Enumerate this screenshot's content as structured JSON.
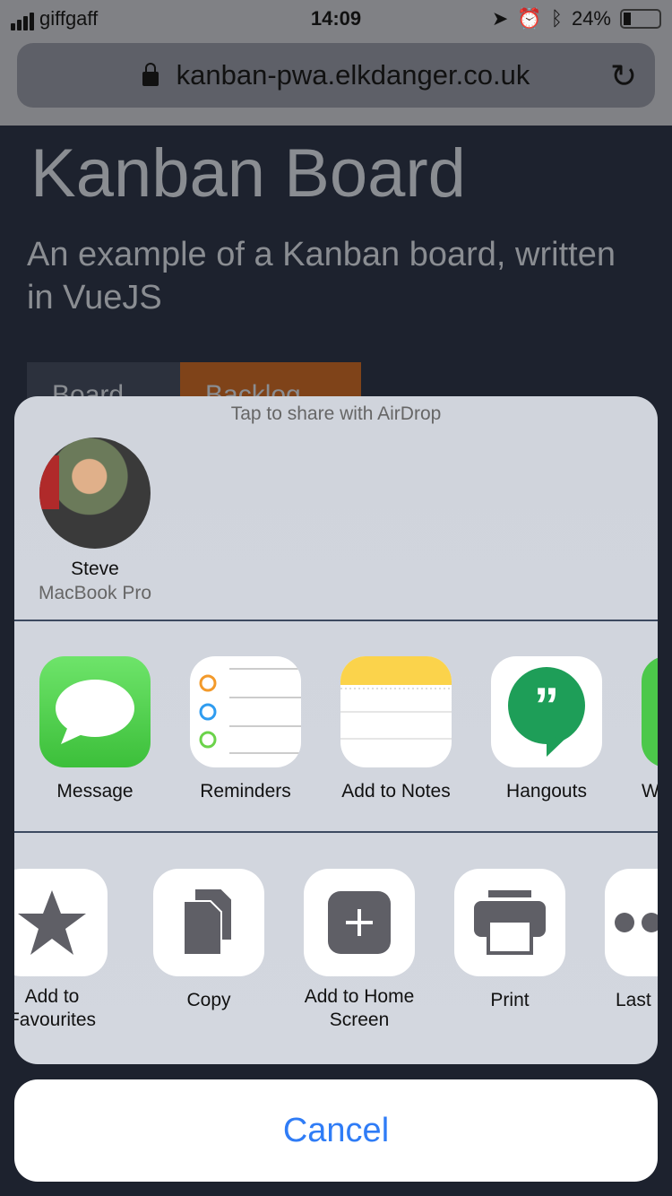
{
  "status_bar": {
    "carrier": "giffgaff",
    "time": "14:09",
    "battery": "24%",
    "battery_level": 0.24
  },
  "browser": {
    "url": "kanban-pwa.elkdanger.co.uk"
  },
  "page": {
    "title": "Kanban Board",
    "subtitle": "An example of a Kanban board, written in VueJS",
    "tabs": [
      {
        "label": "Board"
      },
      {
        "label": "Backlog"
      }
    ]
  },
  "share": {
    "airdrop_hint": "Tap to share with AirDrop",
    "people": [
      {
        "name": "Steve",
        "device": "MacBook Pro"
      }
    ],
    "apps": [
      {
        "label": "Message",
        "icon": "messages-icon"
      },
      {
        "label": "Reminders",
        "icon": "reminders-icon"
      },
      {
        "label": "Add to Notes",
        "icon": "notes-icon"
      },
      {
        "label": "Hangouts",
        "icon": "hangouts-icon"
      },
      {
        "label": "W",
        "icon": "app-icon"
      }
    ],
    "actions": [
      {
        "label": "Add to Favourites",
        "icon": "star-icon"
      },
      {
        "label": "Copy",
        "icon": "copy-icon"
      },
      {
        "label": "Add to Home Screen",
        "icon": "add-icon"
      },
      {
        "label": "Print",
        "icon": "print-icon"
      },
      {
        "label": "Last",
        "icon": "more-icon"
      }
    ],
    "cancel": "Cancel"
  },
  "colors": {
    "accent": "#2f7cf6",
    "backlog_tab": "#7f4319"
  }
}
